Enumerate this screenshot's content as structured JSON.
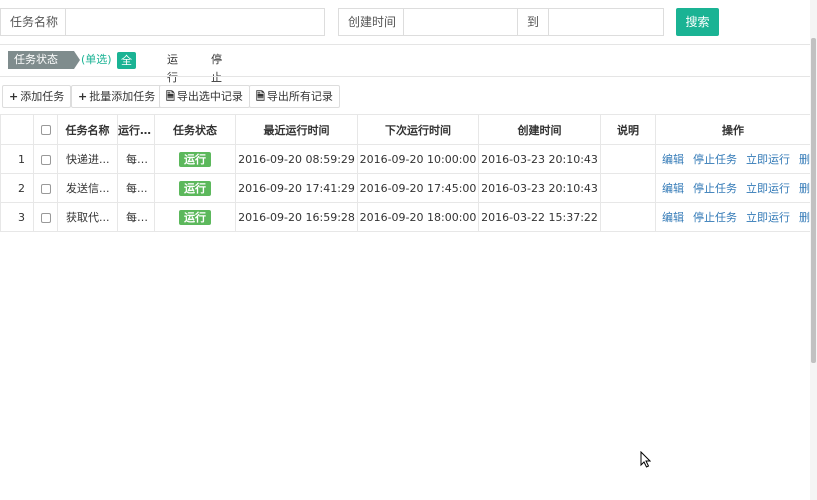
{
  "search": {
    "task_name_label": "任务名称",
    "task_name_value": "",
    "created_label": "创建时间",
    "created_from_value": "",
    "to_label": "到",
    "created_to_value": "",
    "search_button": "搜索"
  },
  "status_filter": {
    "tag": "任务状态",
    "hint": "(单选)",
    "options": [
      "全部",
      "运行",
      "停止"
    ],
    "selected": "全部"
  },
  "toolbar": {
    "add": "添加任务",
    "batch_add": "批量添加任务",
    "export_selected": "导出选中记录",
    "export_all": "导出所有记录"
  },
  "table": {
    "headers": [
      "任务名称",
      "运行频率",
      "任务状态",
      "最近运行时间",
      "下次运行时间",
      "创建时间",
      "说明",
      "操作"
    ],
    "rows": [
      {
        "index": "1",
        "name": "快递进...",
        "freq": "每1...",
        "status": "运行",
        "last_run": "2016-09-20 08:59:29",
        "next_run": "2016-09-20 10:00:00",
        "created": "2016-03-23 20:10:43",
        "note": ""
      },
      {
        "index": "2",
        "name": "发送信...",
        "freq": "每...",
        "status": "运行",
        "last_run": "2016-09-20 17:41:29",
        "next_run": "2016-09-20 17:45:00",
        "created": "2016-03-23 20:10:43",
        "note": ""
      },
      {
        "index": "3",
        "name": "获取代...",
        "freq": "每1...",
        "status": "运行",
        "last_run": "2016-09-20 16:59:28",
        "next_run": "2016-09-20 18:00:00",
        "created": "2016-03-22 15:37:22",
        "note": ""
      }
    ],
    "actions": [
      "编辑",
      "停止任务",
      "立即运行",
      "删除"
    ]
  },
  "colors": {
    "accent": "#1ab394",
    "badge": "#5cb85c",
    "link": "#337ab7",
    "status_tag": "#7f8c8d"
  }
}
